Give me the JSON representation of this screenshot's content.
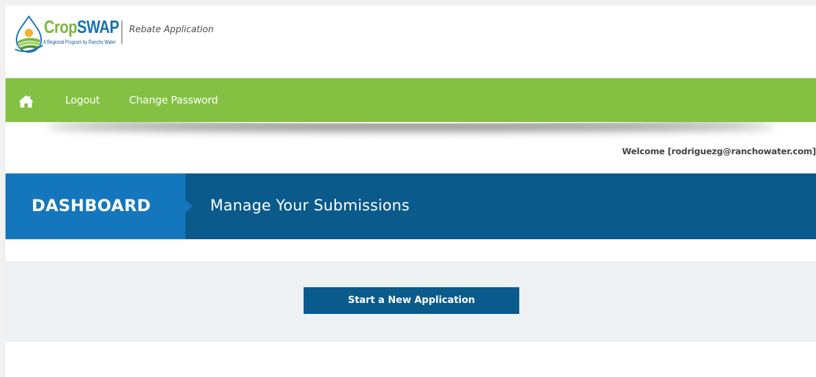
{
  "header": {
    "logo": {
      "word_part1": "Crop",
      "word_part2": "SWAP",
      "tagline": "A Regional Program by Rancho Water",
      "icon": "cropswap-logo-icon"
    },
    "subtitle": "Rebate Application"
  },
  "nav": {
    "home_icon": "home-icon",
    "logout_label": "Logout",
    "change_password_label": "Change Password"
  },
  "welcome": {
    "text": "Welcome [rodriguezg@ranchowater.com]"
  },
  "banner": {
    "title": "DASHBOARD",
    "subtitle": "Manage Your Submissions"
  },
  "main": {
    "start_button_label": "Start a New Application"
  },
  "colors": {
    "nav_green": "#84c142",
    "banner_dark_blue": "#0a5a8c",
    "banner_tab_blue": "#1477bd",
    "panel_bg": "#eef1f4",
    "logo_green": "#79b83a",
    "logo_blue": "#1672b4"
  }
}
